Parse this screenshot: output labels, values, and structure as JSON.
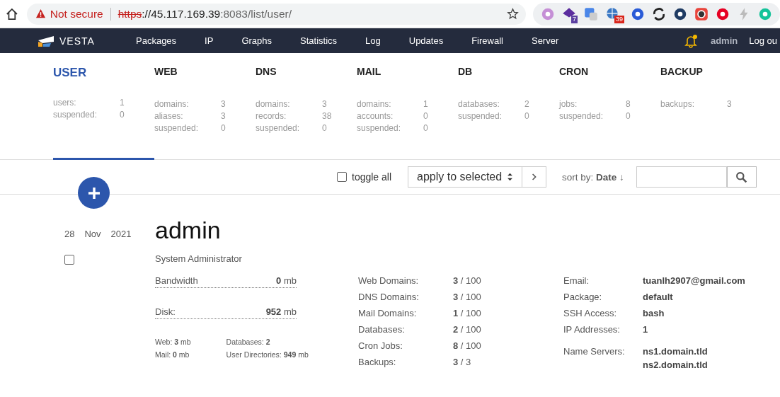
{
  "browser": {
    "security": "Not secure",
    "url_scheme": "https",
    "url_host": "://45.117.169.39",
    "url_path": ":8083/list/user/",
    "extension_badges": [
      "7",
      "39"
    ]
  },
  "nav": {
    "logo": "VESTA",
    "items": [
      "Packages",
      "IP",
      "Graphs",
      "Statistics",
      "Log",
      "Updates",
      "Firewall",
      "Server"
    ],
    "notifications": true,
    "user": "admin",
    "logout": "Log ou"
  },
  "tabs": [
    {
      "title": "USER",
      "selected": true,
      "stats": [
        {
          "label": "users:",
          "value": "1"
        },
        {
          "label": "suspended:",
          "value": "0"
        }
      ]
    },
    {
      "title": "WEB",
      "selected": false,
      "stats": [
        {
          "label": "domains:",
          "value": "3"
        },
        {
          "label": "aliases:",
          "value": "3"
        },
        {
          "label": "suspended:",
          "value": "0"
        }
      ]
    },
    {
      "title": "DNS",
      "selected": false,
      "stats": [
        {
          "label": "domains:",
          "value": "3"
        },
        {
          "label": "records:",
          "value": "38"
        },
        {
          "label": "suspended:",
          "value": "0"
        }
      ]
    },
    {
      "title": "MAIL",
      "selected": false,
      "stats": [
        {
          "label": "domains:",
          "value": "1"
        },
        {
          "label": "accounts:",
          "value": "0"
        },
        {
          "label": "suspended:",
          "value": "0"
        }
      ]
    },
    {
      "title": "DB",
      "selected": false,
      "stats": [
        {
          "label": "databases:",
          "value": "2"
        },
        {
          "label": "suspended:",
          "value": "0"
        }
      ]
    },
    {
      "title": "CRON",
      "selected": false,
      "stats": [
        {
          "label": "jobs:",
          "value": "8"
        },
        {
          "label": "suspended:",
          "value": "0"
        }
      ]
    },
    {
      "title": "BACKUP",
      "selected": false,
      "stats": [
        {
          "label": "backups:",
          "value": "3"
        }
      ]
    }
  ],
  "toolbar": {
    "toggle_all": {
      "label": "toggle all",
      "checked": false
    },
    "bulk_action": "apply to selected",
    "sort_label": "sort by:",
    "sort_field": "Date",
    "sort_direction": "↓"
  },
  "user": {
    "day": "28",
    "month": "Nov",
    "year": "2021",
    "checked": false,
    "name": "admin",
    "full_name": "System Administrator",
    "usage": [
      {
        "label": "Bandwidth",
        "value": "0",
        "unit": "mb"
      },
      {
        "label": "Disk:",
        "value": "952",
        "unit": "mb"
      }
    ],
    "disk_breakdown": [
      [
        "Web: **3** mb",
        "Mail: **0** mb"
      ],
      [
        "Databases: **2**",
        "User Directories: **949** mb"
      ]
    ],
    "limits": [
      {
        "label": "Web Domains:",
        "value": "**3** / 100"
      },
      {
        "label": "DNS Domains:",
        "value": "**3** / 100"
      },
      {
        "label": "Mail Domains:",
        "value": "**1** / 100"
      },
      {
        "label": "Databases:",
        "value": "**2** / 100"
      },
      {
        "label": "Cron Jobs:",
        "value": "**8** / 100"
      },
      {
        "label": "Backups:",
        "value": "**3** / 3"
      }
    ],
    "info": [
      {
        "label": "Email:",
        "values": [
          "tuanlh2907@gmail.com"
        ]
      },
      {
        "label": "Package:",
        "values": [
          "default"
        ]
      },
      {
        "label": "SSH Access:",
        "values": [
          "bash"
        ]
      },
      {
        "label": "IP Addresses:",
        "values": [
          "1"
        ]
      },
      {
        "label": "Name Servers:",
        "values": [
          "ns1.domain.tld",
          "ns2.domain.tld"
        ]
      }
    ]
  }
}
